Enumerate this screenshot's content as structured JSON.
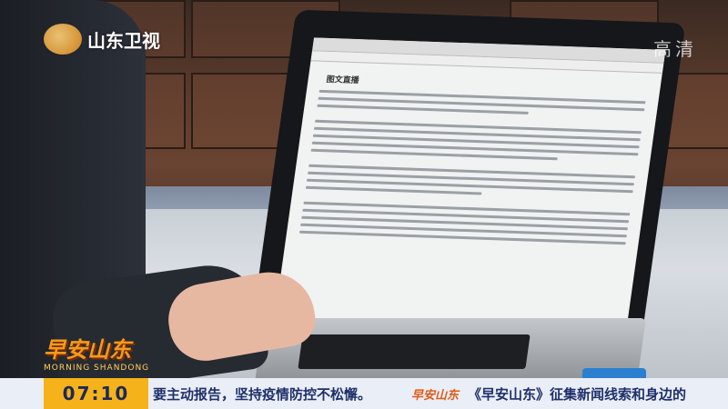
{
  "channel": {
    "logo_text": "山东卫视",
    "quality_badge": "高清"
  },
  "screen_doc": {
    "title": "图文直播"
  },
  "program": {
    "logo_cn": "早安山东",
    "logo_en": "MORNING SHANDONG"
  },
  "ticker": {
    "time": "07:10",
    "message": "要主动报告，坚持疫情防控不松懈。",
    "brand": "早安山东",
    "promo": "《早安山东》征集新闻线索和身边的"
  }
}
